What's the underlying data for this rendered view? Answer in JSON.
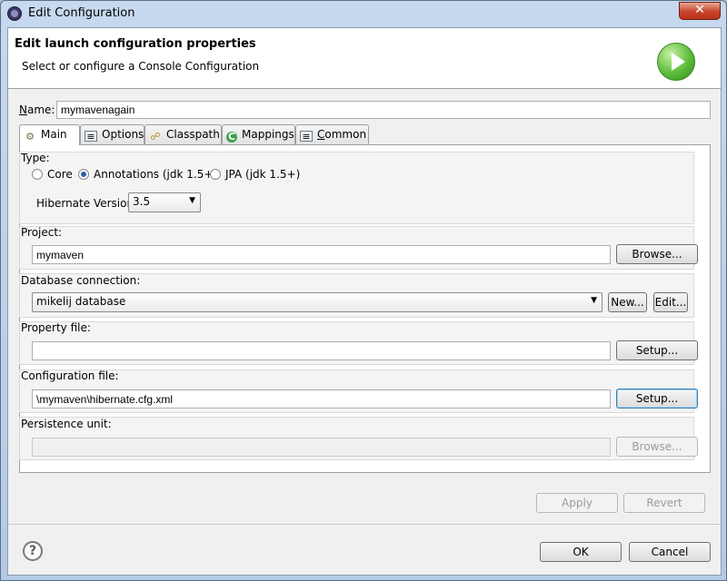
{
  "window": {
    "title": "Edit Configuration",
    "close_glyph": "✕"
  },
  "header": {
    "title": "Edit launch configuration properties",
    "subtitle": "Select or configure a Console Configuration",
    "icon": "run-icon"
  },
  "name": {
    "label": "Name:",
    "value": "mymavenagain"
  },
  "tabs": [
    {
      "label": "Main",
      "icon": "main-tab-icon",
      "active": true
    },
    {
      "label": "Options",
      "icon": "options-tab-icon"
    },
    {
      "label": "Classpath",
      "icon": "classpath-tab-icon"
    },
    {
      "label": "Mappings",
      "icon": "mappings-tab-icon"
    },
    {
      "label": "Common",
      "icon": "common-tab-icon"
    }
  ],
  "type_group": {
    "label": "Type:",
    "options": [
      {
        "label": "Core",
        "selected": false
      },
      {
        "label": "Annotations (jdk 1.5+)",
        "selected": true
      },
      {
        "label": "JPA (jdk 1.5+)",
        "selected": false
      }
    ],
    "hibernate_version_label": "Hibernate Version:",
    "hibernate_version_value": "3.5"
  },
  "project": {
    "label": "Project:",
    "value": "mymaven",
    "browse_label": "Browse..."
  },
  "database": {
    "label": "Database connection:",
    "value": "mikelij database",
    "new_label": "New...",
    "edit_label": "Edit..."
  },
  "property_file": {
    "label": "Property file:",
    "value": "",
    "setup_label": "Setup..."
  },
  "config_file": {
    "label": "Configuration file:",
    "value": "\\mymaven\\hibernate.cfg.xml",
    "setup_label": "Setup..."
  },
  "persistence": {
    "label": "Persistence unit:",
    "value": "",
    "browse_label": "Browse..."
  },
  "actions": {
    "apply_label": "Apply",
    "revert_label": "Revert"
  },
  "footer": {
    "help_glyph": "?",
    "ok_label": "OK",
    "cancel_label": "Cancel"
  },
  "colors": {
    "window_frame": "#b3cae4",
    "run_icon": "#5cbb3a",
    "focus": "#3c7fb1"
  }
}
